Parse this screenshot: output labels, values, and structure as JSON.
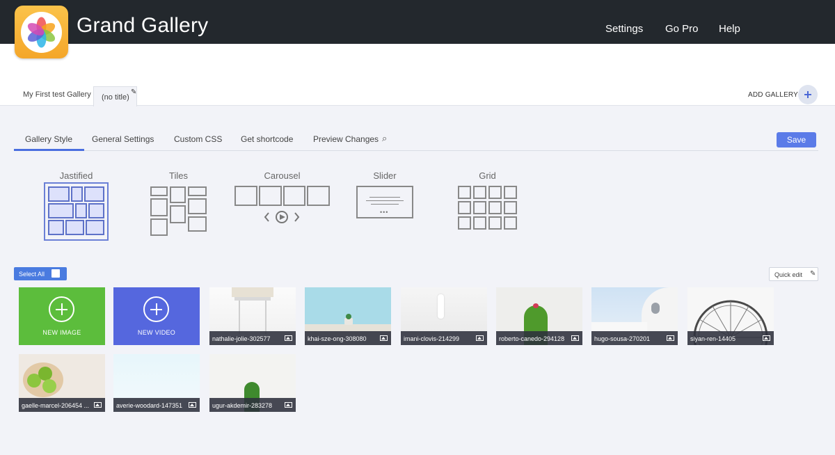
{
  "app": {
    "title": "Grand Gallery"
  },
  "nav": [
    "Settings",
    "Go Pro",
    "Help"
  ],
  "gallery_tabs": [
    {
      "label": "My First test Gallery",
      "active": false
    },
    {
      "label": "(no title)",
      "active": true
    }
  ],
  "add_gallery_label": "ADD GALLERY",
  "settings_tabs": [
    "Gallery Style",
    "General Settings",
    "Custom CSS",
    "Get shortcode",
    "Preview Changes"
  ],
  "active_settings_tab": "Gallery Style",
  "save_label": "Save",
  "styles": [
    "Jastified",
    "Tiles",
    "Carousel",
    "Slider",
    "Grid"
  ],
  "selected_style": "Jastified",
  "select_all_label": "Select All",
  "quick_edit_label": "Quick edit",
  "new_image_label": "NEW IMAGE",
  "new_video_label": "NEW VIDEO",
  "images": [
    {
      "name": "nathalie-jolie-302577"
    },
    {
      "name": "khai-sze-ong-308080"
    },
    {
      "name": "imani-clovis-214299"
    },
    {
      "name": "roberto-canedo-294128"
    },
    {
      "name": "hugo-sousa-270201"
    },
    {
      "name": "siyan-ren-14405"
    },
    {
      "name": "gaelle-marcel-206454 ..."
    },
    {
      "name": "averie-woodard-147351"
    },
    {
      "name": "ugur-akdemir-283278"
    }
  ],
  "colors": {
    "topbar": "#23282d",
    "accent": "#5b7be8",
    "new_image": "#5cbd3c",
    "new_video": "#5567de"
  }
}
